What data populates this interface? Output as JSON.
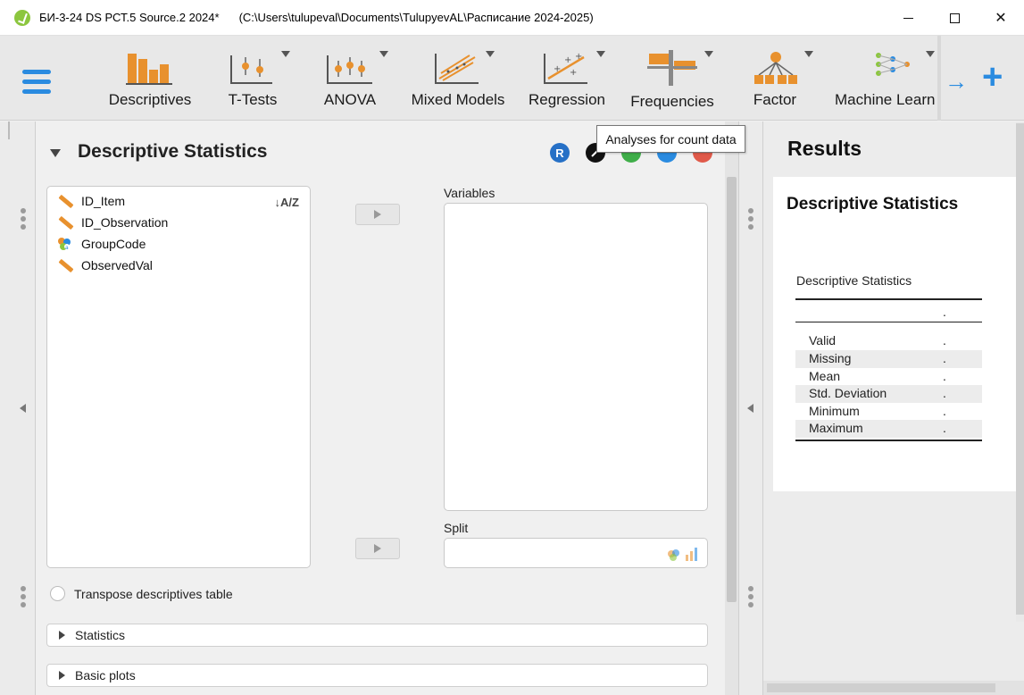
{
  "window": {
    "title": "БИ-3-24 DS РСТ.5 Source.2 2024*",
    "path": "(C:\\Users\\tulupeval\\Documents\\TulupyevAL\\Расписание 2024-2025)",
    "minimize": "—",
    "maximize": "☐",
    "close": "✕"
  },
  "ribbon": {
    "modules": [
      {
        "label": "Descriptives",
        "icon": "descriptives-icon"
      },
      {
        "label": "T-Tests",
        "icon": "t-tests-icon"
      },
      {
        "label": "ANOVA",
        "icon": "anova-icon"
      },
      {
        "label": "Mixed Models",
        "icon": "mixed-models-icon"
      },
      {
        "label": "Regression",
        "icon": "regression-icon"
      },
      {
        "label": "Frequencies",
        "icon": "frequencies-icon"
      },
      {
        "label": "Factor",
        "icon": "factor-icon"
      },
      {
        "label": "Machine Learn",
        "icon": "machine-learning-icon"
      }
    ]
  },
  "analysis": {
    "title": "Descriptive Statistics",
    "variables": [
      {
        "name": "ID_Item",
        "type": "scale"
      },
      {
        "name": "ID_Observation",
        "type": "scale"
      },
      {
        "name": "GroupCode",
        "type": "nominal"
      },
      {
        "name": "ObservedVal",
        "type": "scale"
      }
    ],
    "variables_label": "Variables",
    "split_label": "Split",
    "transpose_label": "Transpose descriptives table",
    "sections": [
      "Statistics",
      "Basic plots"
    ],
    "r_button": "R"
  },
  "tooltip": "Analyses for count data",
  "results": {
    "title": "Results",
    "card_title": "Descriptive Statistics",
    "table_caption": "Descriptive Statistics",
    "header_value": ".",
    "rows": [
      {
        "name": "Valid",
        "value": "."
      },
      {
        "name": "Missing",
        "value": "."
      },
      {
        "name": "Mean",
        "value": "."
      },
      {
        "name": "Std. Deviation",
        "value": "."
      },
      {
        "name": "Minimum",
        "value": "."
      },
      {
        "name": "Maximum",
        "value": "."
      }
    ]
  },
  "colors": {
    "accent": "#2a8be0",
    "scale_icon": "#e8912e",
    "r_blue": "#2670c6",
    "green": "#3fae49",
    "info_blue": "#2a8be0",
    "close_red": "#e05a4a"
  }
}
